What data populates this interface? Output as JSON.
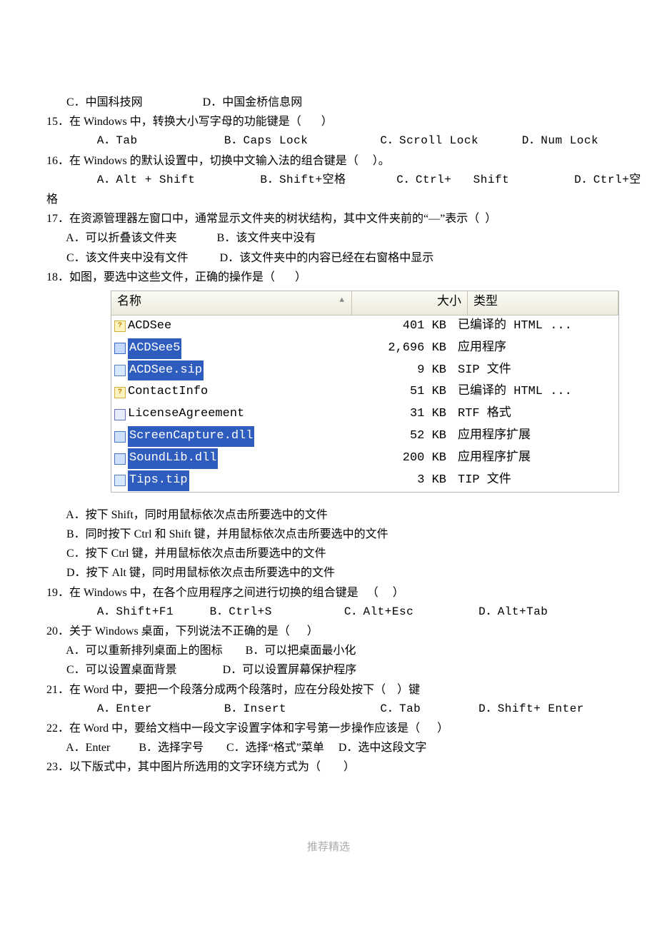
{
  "lines": {
    "l14c": "       C．中国科技网                     D．中国金桥信息网",
    "l15": "15．在 Windows 中，转换大小写字母的功能键是（       ）",
    "l15o": "       A．Tab            B．Caps Lock          C．Scroll Lock      D．Num Lock",
    "l16": "16．在 Windows 的默认设置中，切换中文输入法的组合键是（     ）。",
    "l16o": "       A．Alt + Shift         B．Shift+空格       C．Ctrl+   Shift         D．Ctrl+空",
    "l16o2": "格",
    "l17": "17．在资源管理器左窗口中，通常显示文件夹的树状结构，其中文件夹前的“—”表示（  ）",
    "l17a": "       A．可以折叠该文件夹              B．该文件夹中没有",
    "l17b": "       C．该文件夹中没有文件           D．该文件夹中的内容已经在右窗格中显示",
    "l18": "18．如图，要选中这些文件，正确的操作是（       ）",
    "l18a": "       A．按下 Shift，同时用鼠标依次点击所要选中的文件",
    "l18b": "       B．同时按下 Ctrl 和 Shift 键，并用鼠标依次点击所要选中的文件",
    "l18c": "       C．按下 Ctrl 键，并用鼠标依次点击所要选中的文件",
    "l18d": "       D．按下 Alt 键，同时用鼠标依次点击所要选中的文件",
    "l19": "19．在 Windows 中，在各个应用程序之间进行切换的组合键是   （     ）",
    "l19o": "       A．Shift+F1     B．Ctrl+S          C．Alt+Esc         D．Alt+Tab",
    "l20": "20．关于 Windows 桌面，下列说法不正确的是（      ）",
    "l20a": "       A．可以重新排列桌面上的图标        B．可以把桌面最小化",
    "l20b": "       C．可以设置桌面背景                D．可以设置屏幕保护程序",
    "l21": "21．在 Word 中，要把一个段落分成两个段落时，应在分段处按下（    ）键",
    "l21o": "       A．Enter          B．Insert             C．Tab        D．Shift+ Enter",
    "l22": "22．在 Word 中，要给文档中一段文字设置字体和字号第一步操作应该是（      ）",
    "l22o": "       A．Enter          B．选择字号        C．选择“格式”菜单     D．选中这段文字",
    "l23": "23．以下版式中，其中图片所选用的文字环绕方式为（        ）"
  },
  "filelist": {
    "headers": {
      "name": "名称",
      "size": "大小",
      "type": "类型",
      "sort": "▲"
    },
    "rows": [
      {
        "ico": "chm",
        "name": "ACDSee",
        "size": "401 KB",
        "type": "已编译的 HTML ...",
        "sel": false,
        "q": "?"
      },
      {
        "ico": "exe",
        "name": "ACDSee5",
        "size": "2,696 KB",
        "type": "应用程序",
        "sel": true,
        "q": ""
      },
      {
        "ico": "sip",
        "name": "ACDSee.sip",
        "size": "9 KB",
        "type": "SIP 文件",
        "sel": true,
        "q": ""
      },
      {
        "ico": "chm",
        "name": "ContactInfo",
        "size": "51 KB",
        "type": "已编译的 HTML ...",
        "sel": false,
        "q": "?"
      },
      {
        "ico": "rtf",
        "name": "LicenseAgreement",
        "size": "31 KB",
        "type": "RTF 格式",
        "sel": false,
        "q": ""
      },
      {
        "ico": "dll",
        "name": "ScreenCapture.dll",
        "size": "52 KB",
        "type": "应用程序扩展",
        "sel": true,
        "q": ""
      },
      {
        "ico": "dll",
        "name": "SoundLib.dll",
        "size": "200 KB",
        "type": "应用程序扩展",
        "sel": true,
        "q": ""
      },
      {
        "ico": "tip",
        "name": "Tips.tip",
        "size": "3 KB",
        "type": "TIP 文件",
        "sel": true,
        "q": ""
      }
    ]
  },
  "footer": "推荐精选"
}
